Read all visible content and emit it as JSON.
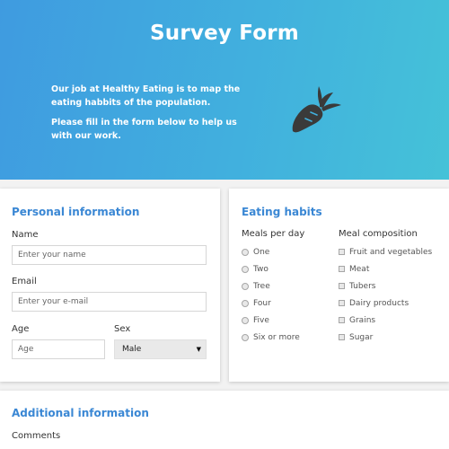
{
  "header": {
    "title": "Survey Form",
    "intro_prefix": "Our job at ",
    "brand": "Healthy Eating",
    "intro_suffix": " is to map the eating habbits of the population.",
    "instruction": "Please fill in the form below to help us with our work.",
    "icon": "carrot-icon"
  },
  "personal": {
    "title": "Personal information",
    "name_label": "Name",
    "name_placeholder": "Enter your name",
    "email_label": "Email",
    "email_placeholder": "Enter your e-mail",
    "age_label": "Age",
    "age_placeholder": "Age",
    "sex_label": "Sex",
    "sex_value": "Male"
  },
  "eating": {
    "title": "Eating habits",
    "meals_label": "Meals per day",
    "meals_options": [
      "One",
      "Two",
      "Tree",
      "Four",
      "Five",
      "Six or more"
    ],
    "composition_label": "Meal composition",
    "composition_options": [
      "Fruit and vegetables",
      "Meat",
      "Tubers",
      "Dairy products",
      "Grains",
      "Sugar"
    ]
  },
  "additional": {
    "title": "Additional information",
    "comments_label": "Comments"
  },
  "colors": {
    "accent": "#3a87d4",
    "gradient_start": "#3f9be0",
    "gradient_end": "#45c2d8",
    "icon": "#3a3a3a"
  }
}
